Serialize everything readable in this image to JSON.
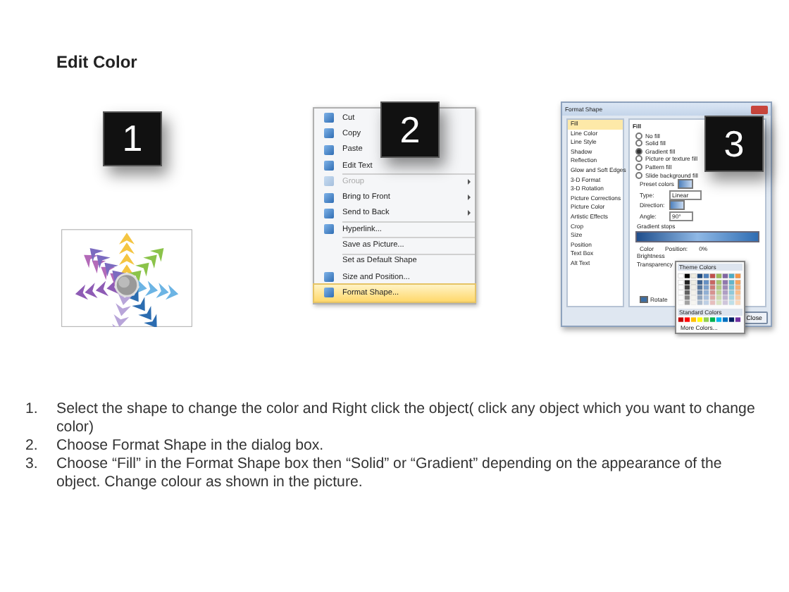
{
  "title": "Edit Color",
  "step_badges": [
    "1",
    "2",
    "3"
  ],
  "context_menu": {
    "items": [
      {
        "label": "Cut",
        "icon": true,
        "disabled": false,
        "submenu": false,
        "selected": false,
        "divider_above": false
      },
      {
        "label": "Copy",
        "icon": true,
        "disabled": false,
        "submenu": false,
        "selected": false,
        "divider_above": false
      },
      {
        "label": "Paste",
        "icon": true,
        "disabled": false,
        "submenu": false,
        "selected": false,
        "divider_above": false
      },
      {
        "label": "Edit Text",
        "icon": true,
        "disabled": false,
        "submenu": false,
        "selected": false,
        "divider_above": false
      },
      {
        "label": "Group",
        "icon": true,
        "disabled": true,
        "submenu": true,
        "selected": false,
        "divider_above": true
      },
      {
        "label": "Bring to Front",
        "icon": true,
        "disabled": false,
        "submenu": true,
        "selected": false,
        "divider_above": false
      },
      {
        "label": "Send to Back",
        "icon": true,
        "disabled": false,
        "submenu": true,
        "selected": false,
        "divider_above": false
      },
      {
        "label": "Hyperlink...",
        "icon": true,
        "disabled": false,
        "submenu": false,
        "selected": false,
        "divider_above": true
      },
      {
        "label": "Save as Picture...",
        "icon": false,
        "disabled": false,
        "submenu": false,
        "selected": false,
        "divider_above": true
      },
      {
        "label": "Set as Default Shape",
        "icon": false,
        "disabled": false,
        "submenu": false,
        "selected": false,
        "divider_above": true
      },
      {
        "label": "Size and Position...",
        "icon": true,
        "disabled": false,
        "submenu": false,
        "selected": false,
        "divider_above": false
      },
      {
        "label": "Format Shape...",
        "icon": true,
        "disabled": false,
        "submenu": false,
        "selected": true,
        "divider_above": false
      }
    ]
  },
  "dialog": {
    "title": "Format Shape",
    "categories": [
      {
        "label": "Fill",
        "selected": true
      },
      {
        "label": "Line Color",
        "selected": false
      },
      {
        "label": "Line Style",
        "selected": false
      },
      {
        "label": "Shadow",
        "selected": false
      },
      {
        "label": "Reflection",
        "selected": false
      },
      {
        "label": "Glow and Soft Edges",
        "selected": false
      },
      {
        "label": "3-D Format",
        "selected": false
      },
      {
        "label": "3-D Rotation",
        "selected": false
      },
      {
        "label": "Picture Corrections",
        "selected": false
      },
      {
        "label": "Picture Color",
        "selected": false
      },
      {
        "label": "Artistic Effects",
        "selected": false
      },
      {
        "label": "Crop",
        "selected": false
      },
      {
        "label": "Size",
        "selected": false
      },
      {
        "label": "Position",
        "selected": false
      },
      {
        "label": "Text Box",
        "selected": false
      },
      {
        "label": "Alt Text",
        "selected": false
      }
    ],
    "section": "Fill",
    "fill_options": [
      {
        "label": "No fill",
        "selected": false
      },
      {
        "label": "Solid fill",
        "selected": false
      },
      {
        "label": "Gradient fill",
        "selected": true
      },
      {
        "label": "Picture or texture fill",
        "selected": false
      },
      {
        "label": "Pattern fill",
        "selected": false
      },
      {
        "label": "Slide background fill",
        "selected": false
      }
    ],
    "fields": [
      {
        "label": "Preset colors",
        "kind": "swatch"
      },
      {
        "label": "Type:",
        "kind": "select",
        "value": "Linear"
      },
      {
        "label": "Direction:",
        "kind": "swatch"
      },
      {
        "label": "Angle:",
        "kind": "spin",
        "value": "90°"
      }
    ],
    "gradient_label": "Gradient stops",
    "color_label": "Color",
    "position_label": "Position:",
    "position_value": "0%",
    "brightness_label": "Brightness",
    "transparency_label": "Transparency",
    "rotate": {
      "label": "Rotate",
      "checked": true
    },
    "close_button": "Close",
    "picker": {
      "theme_label": "Theme Colors",
      "standard_label": "Standard Colors",
      "more_label": "More Colors..."
    }
  },
  "instructions": [
    {
      "number": "1.",
      "text": "Select the shape to change the color and Right click the object( click any object which you want to change color)"
    },
    {
      "number": "2.",
      "text": "Choose Format Shape in the dialog box."
    },
    {
      "number": "3.",
      "text": "Choose “Fill” in the Format Shape box then “Solid” or “Gradient” depending on the appearance of the object. Change colour as shown in the picture."
    }
  ]
}
